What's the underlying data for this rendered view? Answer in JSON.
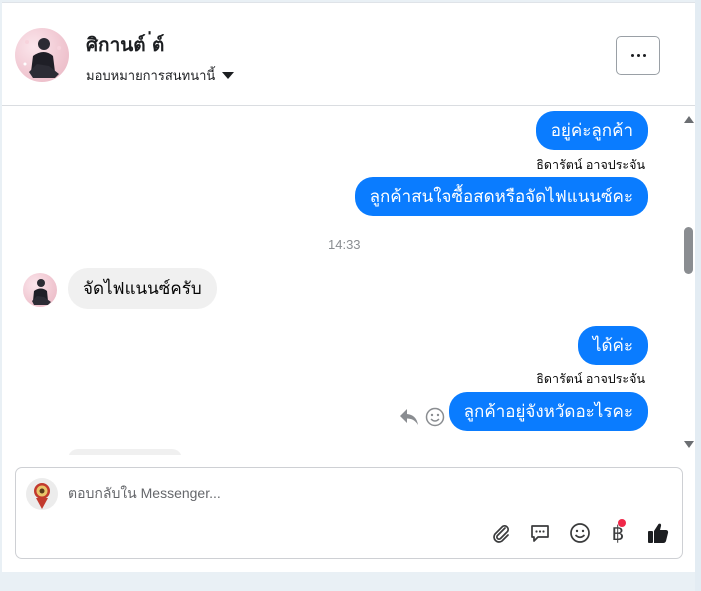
{
  "header": {
    "contact_name": "ศิกานต์ ่ต์",
    "assign_label": "มอบหมายการสนทนานี้"
  },
  "messages": [
    {
      "type": "outgoing",
      "text": "อยู่ค่ะลูกค้า"
    },
    {
      "type": "sender",
      "text": "ธิดารัตน์ อาจประจัน"
    },
    {
      "type": "outgoing",
      "text": "ลูกค้าสนใจซื้อสดหรือจัดไฟแนนซ์คะ"
    },
    {
      "type": "timestamp",
      "text": "14:33"
    },
    {
      "type": "incoming",
      "text": "จัดไฟแนนซ์ครับ"
    },
    {
      "type": "outgoing",
      "text": "ได้ค่ะ"
    },
    {
      "type": "sender",
      "text": "ธิดารัตน์ อาจประจัน"
    },
    {
      "type": "outgoing",
      "text": "ลูกค้าอยู่จังหวัดอะไรคะ"
    }
  ],
  "composer": {
    "placeholder": "ตอบกลับใน Messenger...",
    "value": "",
    "tools": [
      "attach-icon",
      "saved-replies-icon",
      "emoji-icon",
      "payment-icon",
      "like-icon"
    ],
    "payment_symbol": "฿"
  },
  "colors": {
    "outgoing_bubble": "#0a7cff",
    "incoming_bubble": "#f0f0f0",
    "notification_dot": "#f02849"
  }
}
